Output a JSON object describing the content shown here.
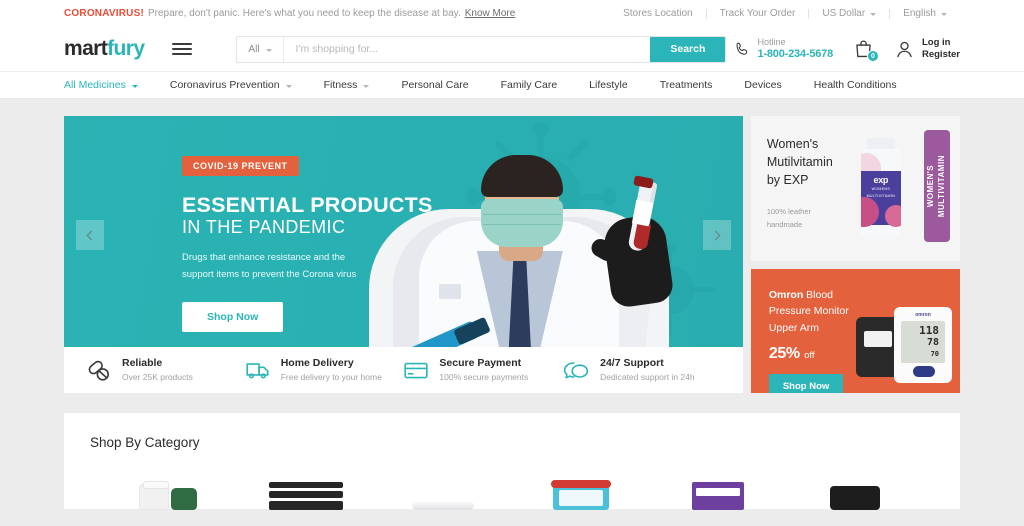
{
  "topbar": {
    "alert_label": "CORONAVIRUS!",
    "alert_text": "Prepare, don't panic. Here's what you need to keep the disease at bay.",
    "alert_link": "Know More",
    "links": [
      "Stores Location",
      "Track Your Order"
    ],
    "currency": "US Dollar",
    "language": "English"
  },
  "header": {
    "logo_part1": "mart",
    "logo_part2": "fury",
    "menu_icon": "hamburger-icon",
    "search": {
      "category": "All",
      "placeholder": "I'm shopping for...",
      "value": "",
      "button": "Search"
    },
    "hotline": {
      "label": "Hotline",
      "number": "1-800-234-5678"
    },
    "cart": {
      "count": "0"
    },
    "account": {
      "line1": "Log in",
      "line2": "Register"
    }
  },
  "nav": {
    "items": [
      {
        "label": "All Medicines",
        "has_caret": true,
        "active": true
      },
      {
        "label": "Coronavirus Prevention",
        "has_caret": true,
        "active": false
      },
      {
        "label": "Fitness",
        "has_caret": true,
        "active": false
      },
      {
        "label": "Personal Care",
        "has_caret": false,
        "active": false
      },
      {
        "label": "Family Care",
        "has_caret": false,
        "active": false
      },
      {
        "label": "Lifestyle",
        "has_caret": false,
        "active": false
      },
      {
        "label": "Treatments",
        "has_caret": false,
        "active": false
      },
      {
        "label": "Devices",
        "has_caret": false,
        "active": false
      },
      {
        "label": "Health Conditions",
        "has_caret": false,
        "active": false
      }
    ]
  },
  "hero": {
    "badge": "COVID-19 PREVENT",
    "title_line1": "ESSENTIAL PRODUCTS",
    "title_line2": "IN THE PANDEMIC",
    "sub_line1": "Drugs that enhance resistance and the",
    "sub_line2": "support items to prevent the Corona virus",
    "cta": "Shop Now",
    "prev_icon": "chevron-left-icon",
    "next_icon": "chevron-right-icon"
  },
  "features": [
    {
      "icon": "pills-icon",
      "title": "Reliable",
      "subtitle": "Over 25K products"
    },
    {
      "icon": "truck-icon",
      "title": "Home Delivery",
      "subtitle": "Free delivery to your home"
    },
    {
      "icon": "credit-card-icon",
      "title": "Secure Payment",
      "subtitle": "100% secure payments"
    },
    {
      "icon": "chat-bubble-icon",
      "title": "24/7 Support",
      "subtitle": "Dedicated support in 24h"
    }
  ],
  "promos": {
    "vitamin": {
      "title_line1": "Women's",
      "title_line2": "Mutilvitamin",
      "title_line3": "by EXP",
      "sub_line1": "100% leather",
      "sub_line2": "handmade",
      "bottle_brand": "exp",
      "bottle_label_line1": "WOMENS",
      "bottle_label_line2": "MULTIVITAMIN",
      "tag_line1": "WOMEN'S",
      "tag_line2": "MULTIVITAMIN"
    },
    "omron": {
      "brand": "Omron",
      "title_rest": "Blood",
      "title_line2": "Pressure Monitor",
      "title_line3": "Upper Arm",
      "discount": "25%",
      "discount_suffix": "off",
      "cta": "Shop Now",
      "device_brand": "omron",
      "reading_sys": "118",
      "reading_dia": "78",
      "reading_pulse": "70"
    }
  },
  "category": {
    "title": "Shop By Category"
  },
  "colors": {
    "accent_teal": "#2bb5b8",
    "alert_red": "#e94b35",
    "promo_orange": "#e4613e",
    "badge_orange": "#e4613e",
    "purple_tag": "#9a5a9b"
  }
}
